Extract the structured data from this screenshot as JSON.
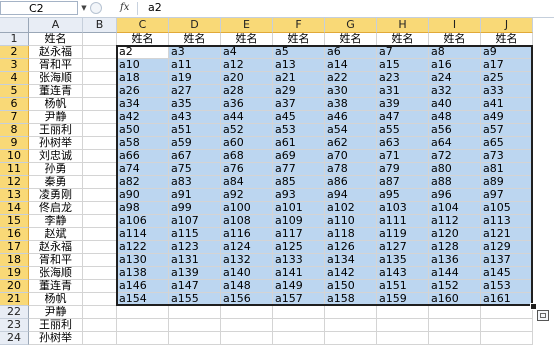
{
  "formula_bar": {
    "name_box": "C2",
    "fx_label": "fx",
    "formula": "a2"
  },
  "columns": [
    "A",
    "B",
    "C",
    "D",
    "E",
    "F",
    "G",
    "H",
    "I",
    "J"
  ],
  "rows": [
    "1",
    "2",
    "3",
    "4",
    "5",
    "6",
    "7",
    "8",
    "9",
    "10",
    "11",
    "12",
    "13",
    "14",
    "15",
    "16",
    "17",
    "18",
    "19",
    "20",
    "21",
    "22",
    "23",
    "24"
  ],
  "column_a": [
    "姓名",
    "赵永福",
    "胥和平",
    "张海顺",
    "董连青",
    "杨帆",
    "尹静",
    "王丽利",
    "孙树举",
    "刘忠诚",
    "孙勇",
    "秦勇",
    "凌勇刚",
    "佟启龙",
    "李静",
    "赵斌",
    "赵永福",
    "胥和平",
    "张海顺",
    "董连青",
    "杨帆",
    "尹静",
    "王丽利",
    "孙树举"
  ],
  "header_row_label": "姓名",
  "data_rows": [
    [
      "a2",
      "a3",
      "a4",
      "a5",
      "a6",
      "a7",
      "a8",
      "a9"
    ],
    [
      "a10",
      "a11",
      "a12",
      "a13",
      "a14",
      "a15",
      "a16",
      "a17"
    ],
    [
      "a18",
      "a19",
      "a20",
      "a21",
      "a22",
      "a23",
      "a24",
      "a25"
    ],
    [
      "a26",
      "a27",
      "a28",
      "a29",
      "a30",
      "a31",
      "a32",
      "a33"
    ],
    [
      "a34",
      "a35",
      "a36",
      "a37",
      "a38",
      "a39",
      "a40",
      "a41"
    ],
    [
      "a42",
      "a43",
      "a44",
      "a45",
      "a46",
      "a47",
      "a48",
      "a49"
    ],
    [
      "a50",
      "a51",
      "a52",
      "a53",
      "a54",
      "a55",
      "a56",
      "a57"
    ],
    [
      "a58",
      "a59",
      "a60",
      "a61",
      "a62",
      "a63",
      "a64",
      "a65"
    ],
    [
      "a66",
      "a67",
      "a68",
      "a69",
      "a70",
      "a71",
      "a72",
      "a73"
    ],
    [
      "a74",
      "a75",
      "a76",
      "a77",
      "a78",
      "a79",
      "a80",
      "a81"
    ],
    [
      "a82",
      "a83",
      "a84",
      "a85",
      "a86",
      "a87",
      "a88",
      "a89"
    ],
    [
      "a90",
      "a91",
      "a92",
      "a93",
      "a94",
      "a95",
      "a96",
      "a97"
    ],
    [
      "a98",
      "a99",
      "a100",
      "a101",
      "a102",
      "a103",
      "a104",
      "a105"
    ],
    [
      "a106",
      "a107",
      "a108",
      "a109",
      "a110",
      "a111",
      "a112",
      "a113"
    ],
    [
      "a114",
      "a115",
      "a116",
      "a117",
      "a118",
      "a119",
      "a120",
      "a121"
    ],
    [
      "a122",
      "a123",
      "a124",
      "a125",
      "a126",
      "a127",
      "a128",
      "a129"
    ],
    [
      "a130",
      "a131",
      "a132",
      "a133",
      "a134",
      "a135",
      "a136",
      "a137"
    ],
    [
      "a138",
      "a139",
      "a140",
      "a141",
      "a142",
      "a143",
      "a144",
      "a145"
    ],
    [
      "a146",
      "a147",
      "a148",
      "a149",
      "a150",
      "a151",
      "a152",
      "a153"
    ],
    [
      "a154",
      "a155",
      "a156",
      "a157",
      "a158",
      "a159",
      "a160",
      "a161"
    ]
  ],
  "colors": {
    "selection": "#bcd6f0",
    "header_bg": "#e8edf5",
    "header_selected": "#f9d977",
    "gridline": "#d4d4d4"
  }
}
